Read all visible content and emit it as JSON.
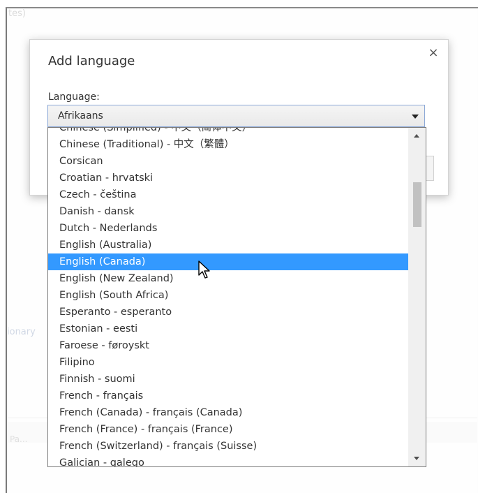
{
  "background": {
    "top_text": "tes)",
    "side_text": "ionary",
    "bottom_text": "Pa..."
  },
  "dialog": {
    "title": "Add language",
    "close_icon": "close-icon",
    "close_glyph": "×",
    "field_label": "Language:",
    "selected_value": "Afrikaans"
  },
  "dropdown": {
    "options": [
      "Chinese (Simplified) - 中文（简体中文）",
      "Chinese (Traditional) - 中文（繁體）",
      "Corsican",
      "Croatian - hrvatski",
      "Czech - čeština",
      "Danish - dansk",
      "Dutch - Nederlands",
      "English (Australia)",
      "English (Canada)",
      "English (New Zealand)",
      "English (South Africa)",
      "Esperanto - esperanto",
      "Estonian - eesti",
      "Faroese - føroyskt",
      "Filipino",
      "Finnish - suomi",
      "French - français",
      "French (Canada) - français (Canada)",
      "French (France) - français (France)",
      "French (Switzerland) - français (Suisse)",
      "Galician - galego"
    ],
    "highlighted": "English (Canada)"
  },
  "colors": {
    "highlight": "#3399ff",
    "border_focus": "#8aa7d6"
  }
}
